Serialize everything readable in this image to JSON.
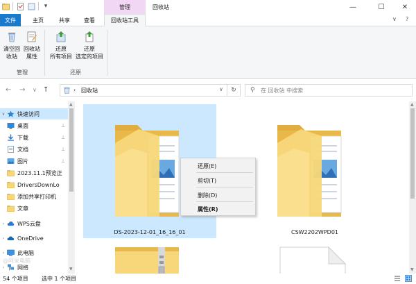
{
  "window": {
    "title": "回收站",
    "context_tab_group": "管理",
    "min_label": "—",
    "max_label": "☐",
    "close_label": "✕"
  },
  "quick_access_toolbar": {
    "items": [
      "app-icon",
      "properties-icon",
      "new-folder-icon"
    ],
    "dropdown": "▾"
  },
  "ribbon": {
    "tabs": [
      "文件",
      "主页",
      "共享",
      "查看",
      "回收站工具"
    ],
    "active_tab": "回收站工具",
    "collapse_label": "∨",
    "help_label": "?",
    "groups": [
      {
        "label": "管理",
        "buttons": [
          {
            "line1": "清空回",
            "line2": "收站"
          },
          {
            "line1": "回收站",
            "line2": "属性"
          }
        ]
      },
      {
        "label": "还原",
        "buttons": [
          {
            "line1": "还原",
            "line2": "所有项目"
          },
          {
            "line1": "还原",
            "line2": "选定的项目"
          }
        ]
      }
    ]
  },
  "address_bar": {
    "back": "←",
    "forward": "→",
    "recent": "∨",
    "up": "↑",
    "chevron": "›",
    "path": "回收站",
    "dropdown": "∨",
    "refresh": "↻"
  },
  "search": {
    "icon": "⚲",
    "placeholder": "在 回收站 中搜索"
  },
  "nav_pane": {
    "items": [
      {
        "label": "快速访问",
        "icon": "star-icon",
        "level": 0,
        "expand": "∨",
        "selected": true
      },
      {
        "label": "桌面",
        "icon": "desktop-icon",
        "level": 1,
        "pinned": true
      },
      {
        "label": "下载",
        "icon": "download-icon",
        "level": 1,
        "pinned": true
      },
      {
        "label": "文档",
        "icon": "documents-icon",
        "level": 1,
        "pinned": true
      },
      {
        "label": "图片",
        "icon": "pictures-icon",
        "level": 1,
        "pinned": true
      },
      {
        "label": "2023.11.1预览正",
        "icon": "folder-icon",
        "level": 1
      },
      {
        "label": "DriversDownLo",
        "icon": "folder-icon",
        "level": 1
      },
      {
        "label": "添加共享打印机",
        "icon": "folder-icon",
        "level": 1
      },
      {
        "label": "文章",
        "icon": "folder-icon",
        "level": 1
      },
      {
        "label": "WPS云盘",
        "icon": "wps-cloud-icon",
        "level": 0,
        "expand": "›"
      },
      {
        "label": "OneDrive",
        "icon": "onedrive-icon",
        "level": 0,
        "expand": "›"
      },
      {
        "label": "此电脑",
        "icon": "computer-icon",
        "level": 0,
        "expand": "›"
      },
      {
        "label": "网络",
        "icon": "network-icon",
        "level": 0,
        "expand": "›"
      }
    ],
    "pin_glyph": "⊥"
  },
  "files": [
    {
      "name": "DS-2023-12-01_16_16_01",
      "icon": "folder-with-docs-icon",
      "selected": true
    },
    {
      "name": "CSW2202WPD01",
      "icon": "folder-with-docs-icon",
      "selected": false
    },
    {
      "name": "",
      "icon": "zip-folder-icon",
      "selected": false
    },
    {
      "name": "",
      "icon": "file-icon",
      "selected": false
    }
  ],
  "context_menu": {
    "items": [
      {
        "label": "还原(E)",
        "bold": false
      },
      {
        "label": "剪切(T)",
        "bold": false
      },
      {
        "label": "删除(D)",
        "bold": false
      },
      {
        "label": "属性(R)",
        "bold": true
      }
    ]
  },
  "status_bar": {
    "item_count": "54 个项目",
    "selected_count": "选中 1 个项目"
  },
  "watermark": "@阿呆电脑",
  "colors": {
    "accent": "#1979ca",
    "selection": "#cce8ff",
    "context_tab": "#f1d7f3",
    "folder": "#f7d77a",
    "folder_dark": "#e8b94a"
  }
}
